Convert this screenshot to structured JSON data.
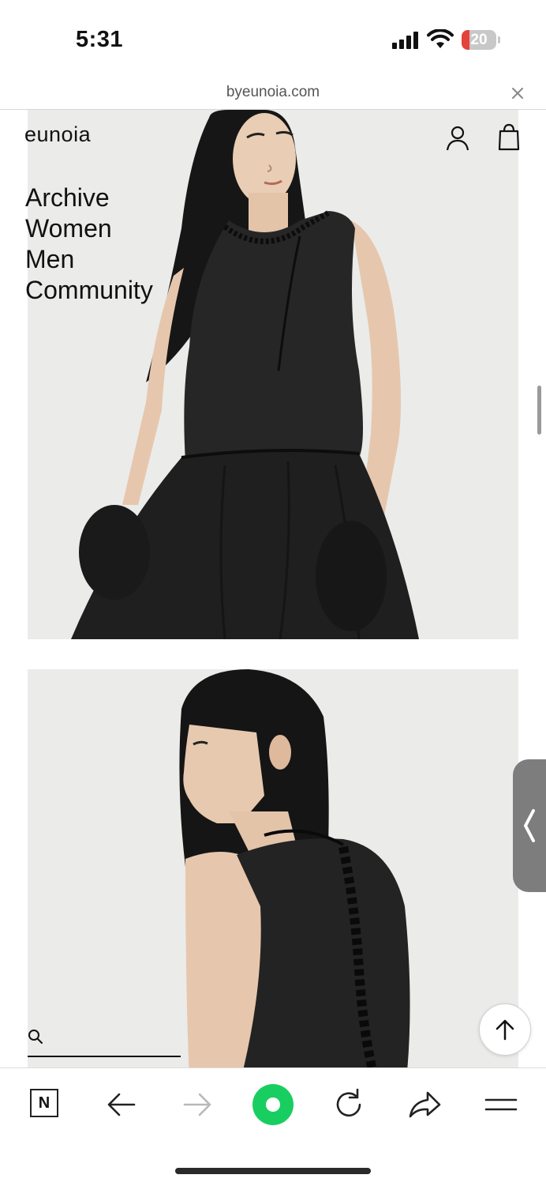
{
  "status_bar": {
    "time": "5:31",
    "battery_level": "20"
  },
  "url_bar": {
    "domain": "byeunoia.com",
    "close_icon": "close-icon"
  },
  "site": {
    "logo": "eunoia",
    "nav": [
      {
        "label": "Archive"
      },
      {
        "label": "Women"
      },
      {
        "label": "Men"
      },
      {
        "label": "Community"
      }
    ],
    "icons": {
      "account": "user-icon",
      "cart": "shopping-bag-icon",
      "search": "search-icon",
      "back_to_top": "arrow-up-icon"
    }
  },
  "toolbar": {
    "items": [
      "naver-n-icon",
      "back-arrow-icon",
      "forward-arrow-icon",
      "green-home-button",
      "reload-icon",
      "share-icon",
      "menu-icon"
    ]
  },
  "colors": {
    "accent_green": "#19ce60",
    "battery_red": "#e4423a",
    "photo_bg": "#ebebea"
  }
}
